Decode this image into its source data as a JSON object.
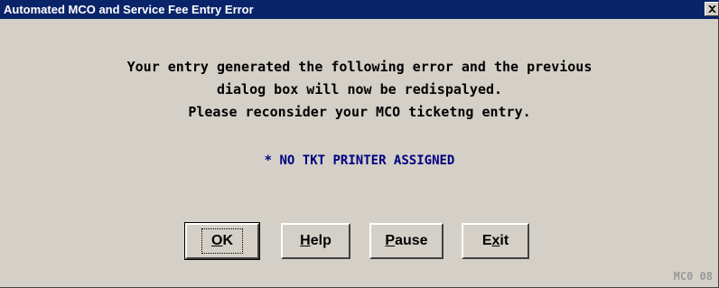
{
  "window": {
    "title": "Automated MCO and Service Fee Entry Error",
    "close_icon": "close-icon"
  },
  "message": {
    "lines": [
      "Your entry generated the following error and the previous",
      "dialog box will now be redispalyed.",
      "Please reconsider your MCO ticketng entry."
    ]
  },
  "error": {
    "text": "* NO TKT PRINTER ASSIGNED"
  },
  "buttons": {
    "ok": {
      "label": "OK",
      "mnemonic": "O",
      "rest": "K"
    },
    "help": {
      "label": "Help",
      "mnemonic": "H",
      "rest": "elp"
    },
    "pause": {
      "label": "Pause",
      "mnemonic": "P",
      "rest": "ause"
    },
    "exit": {
      "label": "Exit",
      "pre": "E",
      "mnemonic": "x",
      "rest": "it"
    }
  },
  "screen_code": "MC0 08",
  "colors": {
    "titlebar": "#0a246a",
    "face": "#d4d0c8",
    "error_text": "#000080"
  }
}
